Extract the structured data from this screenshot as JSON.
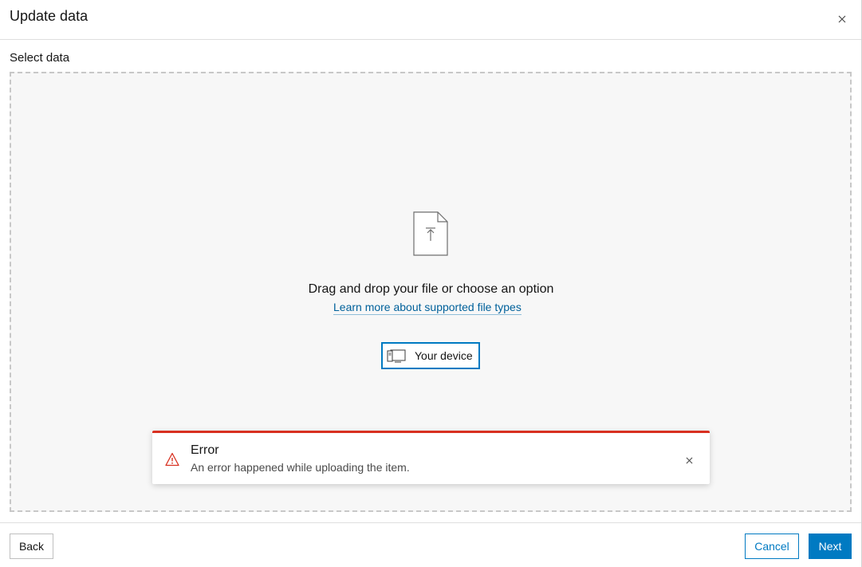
{
  "dialog": {
    "title": "Update data",
    "close_icon": "close-icon"
  },
  "select_data": {
    "label": "Select data",
    "file_icon": "file-upload-icon",
    "heading": "Drag and drop your file or choose an option",
    "learn_more_link": "Learn more about supported file types",
    "device_button": {
      "icon": "device-icon",
      "label": "Your device"
    }
  },
  "alert": {
    "icon": "warning-icon",
    "title": "Error",
    "message": "An error happened while uploading the item.",
    "close_icon": "close-icon",
    "accent_color": "#d83020"
  },
  "footer": {
    "back_label": "Back",
    "cancel_label": "Cancel",
    "next_label": "Next"
  },
  "colors": {
    "brand": "#007ac2",
    "link": "#00619b",
    "error": "#d83020"
  }
}
